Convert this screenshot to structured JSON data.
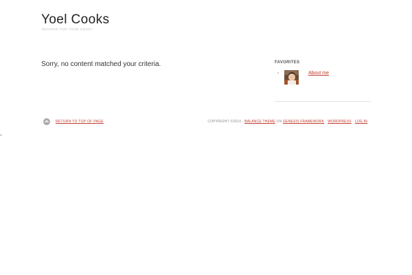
{
  "header": {
    "site_title": "Yoel Cooks",
    "tagline": "RECIPES FOR YOUR ENJOY"
  },
  "main": {
    "message": "Sorry, no content matched your criteria."
  },
  "sidebar": {
    "widget_title": "FAVORITES",
    "items": [
      {
        "label": "About me",
        "bullet": "›",
        "thumbnail": "profile-photo"
      }
    ]
  },
  "footer": {
    "back_to_top": "RETURN TO TOP OF PAGE",
    "back_to_top_icon": "arrow-up-icon",
    "copyright": "COPYRIGHT ©2014 ·",
    "theme_link": "BALANCE THEME",
    "on_text": "ON",
    "framework_link": "GENESIS FRAMEWORK",
    "sep1": "·",
    "wordpress_link": "WORDPRESS",
    "sep2": "·",
    "login_link": "LOG IN"
  },
  "edge_glyph": "»",
  "colors": {
    "link": "#c0392b",
    "muted": "#8a8a8a",
    "text": "#333333"
  }
}
